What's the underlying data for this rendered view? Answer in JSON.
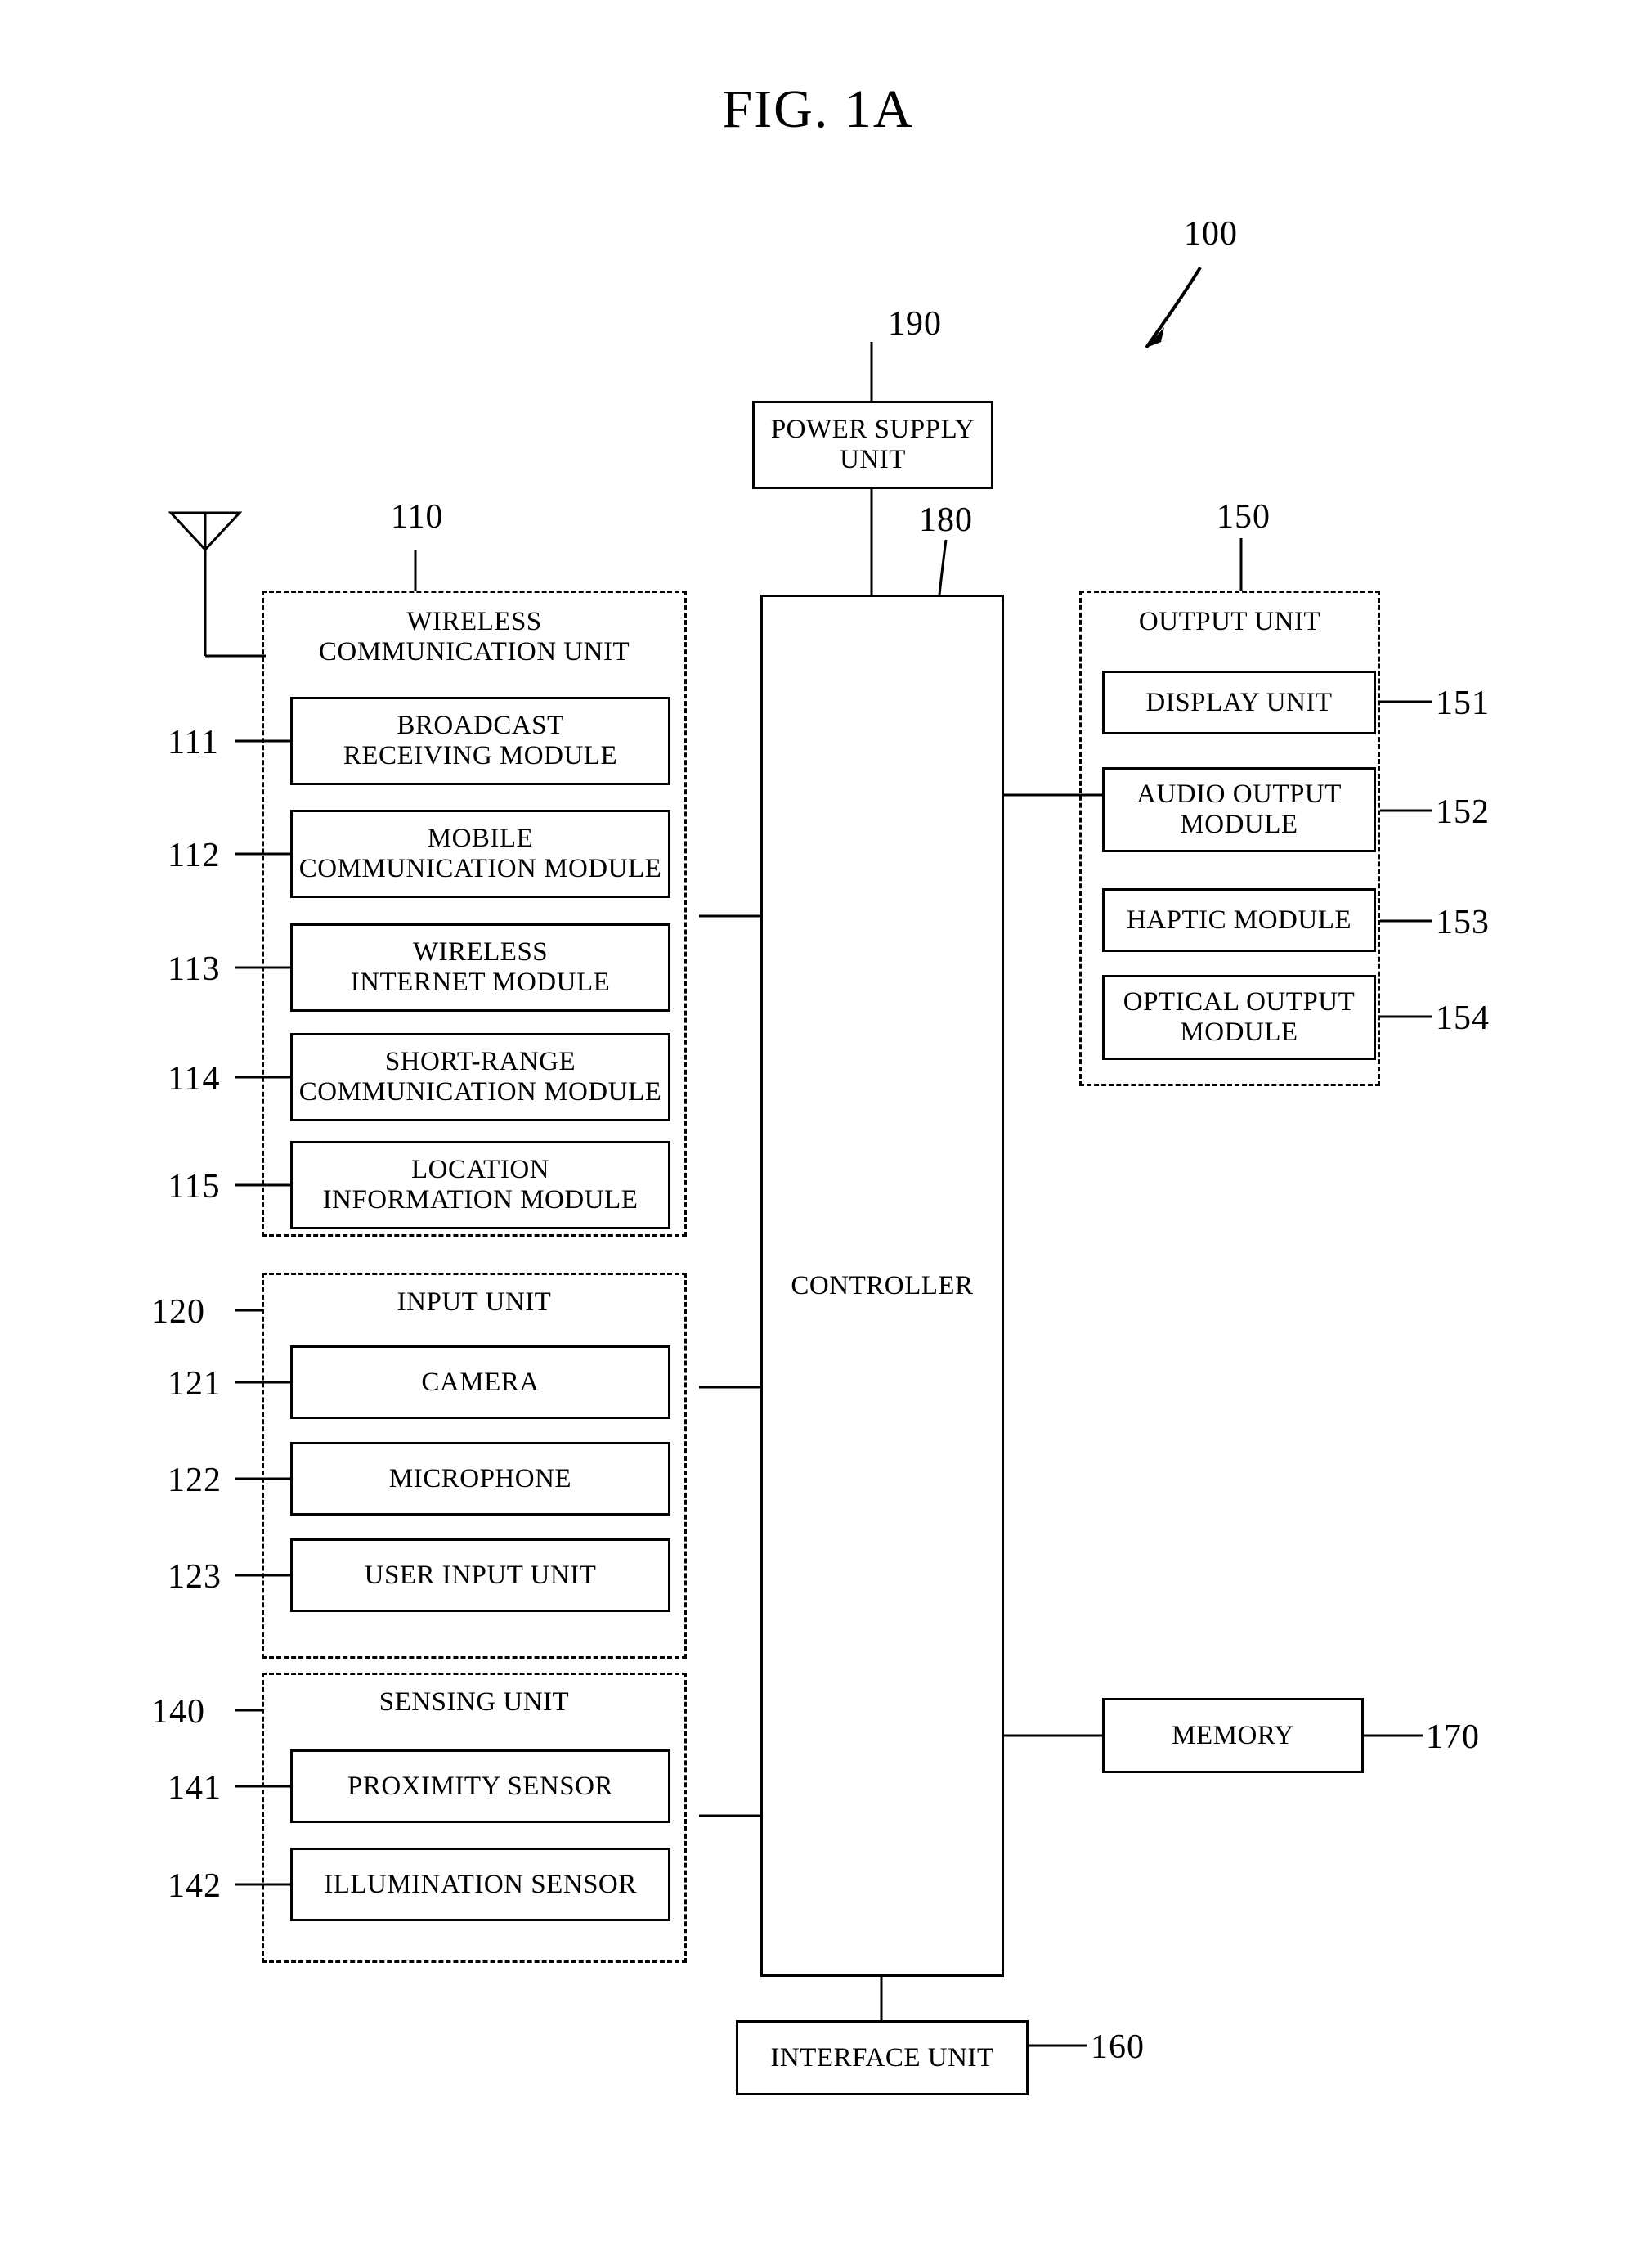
{
  "figure": {
    "title": "FIG. 1A",
    "device_ref": "100"
  },
  "power_supply": {
    "label": "POWER SUPPLY\nUNIT",
    "ref": "190"
  },
  "controller": {
    "label": "CONTROLLER",
    "ref": "180"
  },
  "wireless_communication_unit": {
    "title": "WIRELESS\nCOMMUNICATION UNIT",
    "ref": "110",
    "modules": [
      {
        "ref": "111",
        "label": "BROADCAST\nRECEIVING MODULE"
      },
      {
        "ref": "112",
        "label": "MOBILE\nCOMMUNICATION MODULE"
      },
      {
        "ref": "113",
        "label": "WIRELESS\nINTERNET MODULE"
      },
      {
        "ref": "114",
        "label": "SHORT-RANGE\nCOMMUNICATION MODULE"
      },
      {
        "ref": "115",
        "label": "LOCATION\nINFORMATION MODULE"
      }
    ]
  },
  "input_unit": {
    "title": "INPUT UNIT",
    "ref": "120",
    "modules": [
      {
        "ref": "121",
        "label": "CAMERA"
      },
      {
        "ref": "122",
        "label": "MICROPHONE"
      },
      {
        "ref": "123",
        "label": "USER INPUT UNIT"
      }
    ]
  },
  "sensing_unit": {
    "title": "SENSING UNIT",
    "ref": "140",
    "modules": [
      {
        "ref": "141",
        "label": "PROXIMITY SENSOR"
      },
      {
        "ref": "142",
        "label": "ILLUMINATION SENSOR"
      }
    ]
  },
  "output_unit": {
    "title": "OUTPUT UNIT",
    "ref": "150",
    "modules": [
      {
        "ref": "151",
        "label": "DISPLAY UNIT"
      },
      {
        "ref": "152",
        "label": "AUDIO OUTPUT\nMODULE"
      },
      {
        "ref": "153",
        "label": "HAPTIC MODULE"
      },
      {
        "ref": "154",
        "label": "OPTICAL OUTPUT\nMODULE"
      }
    ]
  },
  "memory": {
    "label": "MEMORY",
    "ref": "170"
  },
  "interface_unit": {
    "label": "INTERFACE UNIT",
    "ref": "160"
  },
  "antenna": {
    "name": "antenna-symbol"
  }
}
